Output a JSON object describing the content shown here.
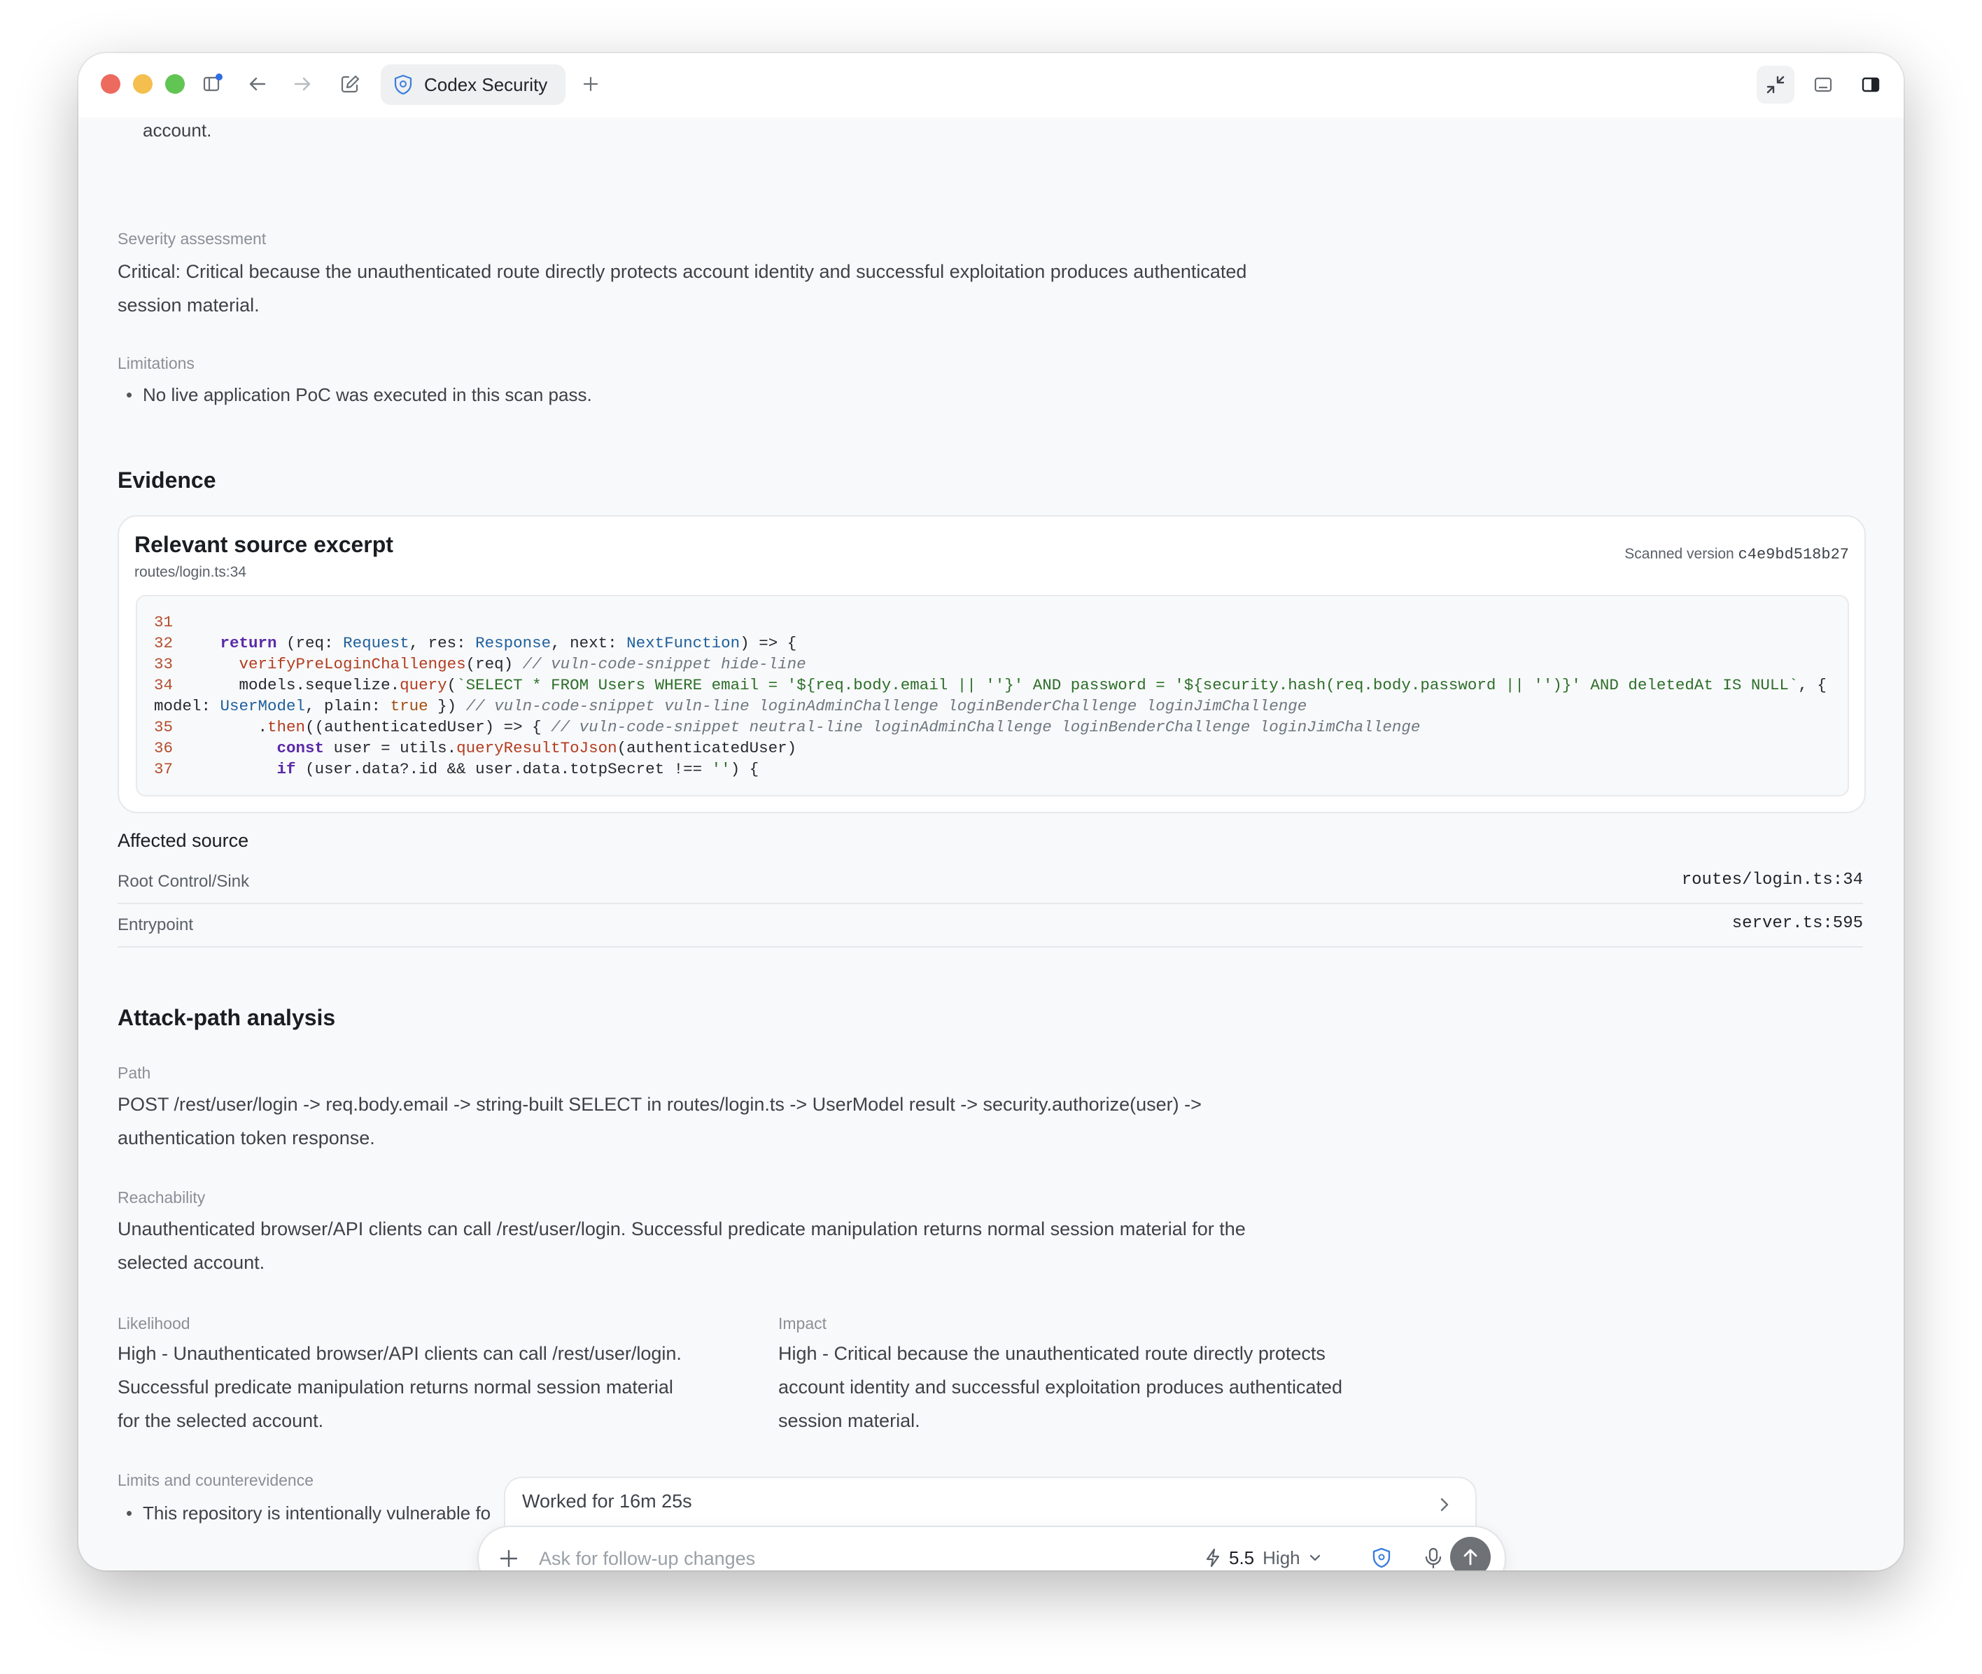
{
  "window": {
    "tab_title": "Codex Security"
  },
  "finding": {
    "top_fragment": "account.",
    "severity_label": "Severity assessment",
    "severity_text_line1": "Critical: Critical because the unauthenticated route directly protects account identity and successful exploitation produces authenticated",
    "severity_text_line2": "session material.",
    "limitations_label": "Limitations",
    "limitations": [
      "No live application PoC was executed in this scan pass."
    ]
  },
  "evidence": {
    "heading": "Evidence",
    "card_title": "Relevant source excerpt",
    "file_ref": "routes/login.ts:34",
    "scanned_label": "Scanned version",
    "scanned_hash": "c4e9bd518b27",
    "code_lines": [
      "31",
      "32     return (req: Request, res: Response, next: NextFunction) => {",
      "33       verifyPreLoginChallenges(req) // vuln-code-snippet hide-line",
      "34       models.sequelize.query(`SELECT * FROM Users WHERE email = '${req.body.email || ''}' AND password = '${security.hash(req.body.password || '')}' AND deletedAt IS NULL`, {",
      "model: UserModel, plain: true }) // vuln-code-snippet vuln-line loginAdminChallenge loginBenderChallenge loginJimChallenge",
      "35         .then((authenticatedUser) => { // vuln-code-snippet neutral-line loginAdminChallenge loginBenderChallenge loginJimChallenge",
      "36           const user = utils.queryResultToJson(authenticatedUser)",
      "37           if (user.data?.id && user.data.totpSecret !== '') {"
    ]
  },
  "affected": {
    "heading": "Affected source",
    "rows": [
      {
        "key": "Root Control/Sink",
        "value": "routes/login.ts:34"
      },
      {
        "key": "Entrypoint",
        "value": "server.ts:595"
      }
    ]
  },
  "attack": {
    "heading": "Attack-path analysis",
    "path_label": "Path",
    "path_line1": "POST /rest/user/login -> req.body.email -> string-built SELECT in routes/login.ts -> UserModel result -> security.authorize(user) ->",
    "path_line2": "authentication token response.",
    "reach_label": "Reachability",
    "reach_line1": "Unauthenticated browser/API clients can call /rest/user/login. Successful predicate manipulation returns normal session material for the",
    "reach_line2": "selected account.",
    "likelihood_label": "Likelihood",
    "likelihood_lines": [
      "High - Unauthenticated browser/API clients can call /rest/user/login.",
      "Successful predicate manipulation returns normal session material",
      "for the selected account."
    ],
    "impact_label": "Impact",
    "impact_lines": [
      "High - Critical because the unauthenticated route directly protects",
      "account identity and successful exploitation produces authenticated",
      "session material."
    ],
    "limits_label": "Limits and counterevidence",
    "limits_bullet": "This repository is intentionally vulnerable fo"
  },
  "status": {
    "worked": "Worked for 16m 25s"
  },
  "composer": {
    "placeholder": "Ask for follow-up changes",
    "model_version": "5.5",
    "reasoning_level": "High"
  }
}
